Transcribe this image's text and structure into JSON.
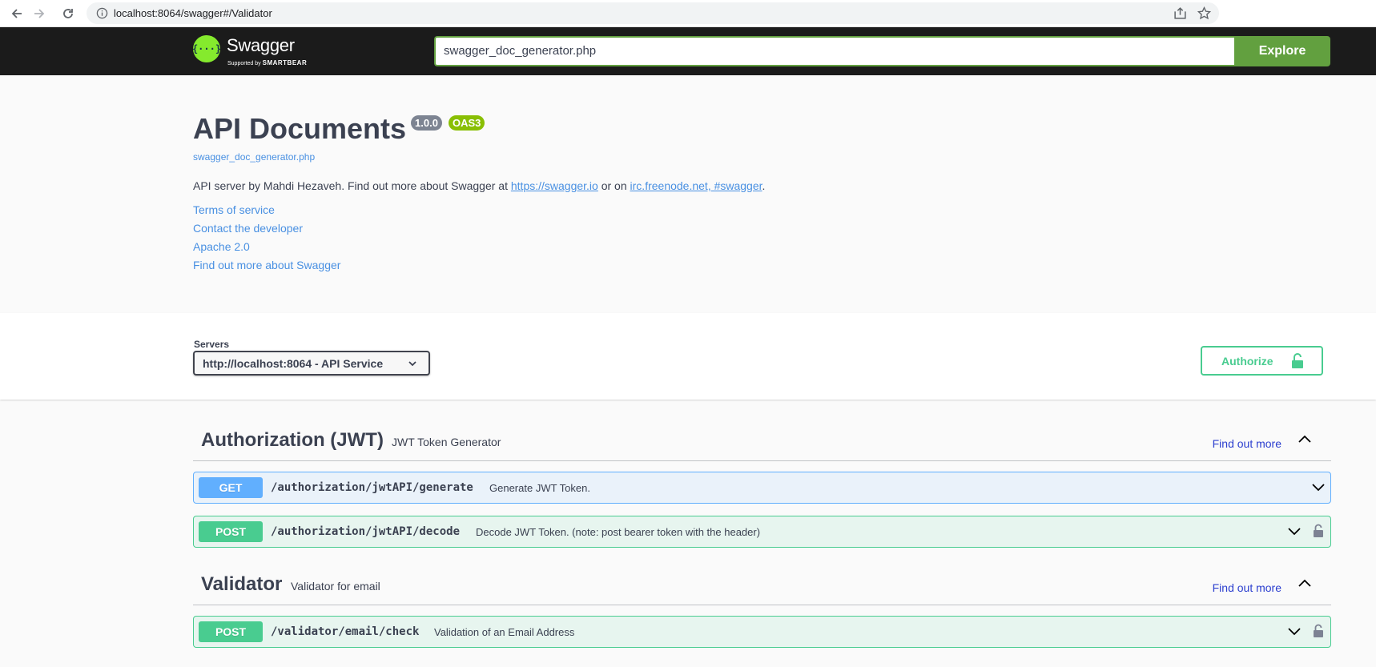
{
  "browser": {
    "url": "localhost:8064/swagger#/Validator"
  },
  "topbar": {
    "logo_text": "Swagger",
    "logo_mark": "{···}",
    "logo_sub_prefix": "Supported by",
    "logo_sub_brand": "SMARTBEAR",
    "explore_value": "swagger_doc_generator.php",
    "explore_label": "Explore"
  },
  "info": {
    "title": "API Documents",
    "version": "1.0.0",
    "oas": "OAS3",
    "spec_link": "swagger_doc_generator.php",
    "description_prefix": "API server by Mahdi Hezaveh. Find out more about Swagger at ",
    "description_link1": "https://swagger.io",
    "description_middle": " or on ",
    "description_link2": "irc.freenode.net, #swagger",
    "description_suffix": ".",
    "terms": "Terms of service",
    "contact": "Contact the developer",
    "license": "Apache 2.0",
    "external_docs": "Find out more about Swagger"
  },
  "scheme": {
    "servers_label": "Servers",
    "server_selected": "http://localhost:8064 - API Service",
    "authorize_label": "Authorize"
  },
  "tags": [
    {
      "name": "Authorization (JWT)",
      "description": "JWT Token Generator",
      "find_more": "Find out more",
      "operations": [
        {
          "method": "GET",
          "path": "/authorization/jwtAPI/generate",
          "summary": "Generate JWT Token.",
          "locked": false
        },
        {
          "method": "POST",
          "path": "/authorization/jwtAPI/decode",
          "summary": "Decode JWT Token. (note: post bearer token with the header)",
          "locked": true
        }
      ]
    },
    {
      "name": "Validator",
      "description": "Validator for email",
      "find_more": "Find out more",
      "operations": [
        {
          "method": "POST",
          "path": "/validator/email/check",
          "summary": "Validation of an Email Address",
          "locked": true
        }
      ]
    }
  ],
  "colors": {
    "get": "#61affe",
    "post": "#49cc90",
    "topbar": "#1b1b1b",
    "explore": "#62a03f",
    "link": "#4990e2"
  }
}
